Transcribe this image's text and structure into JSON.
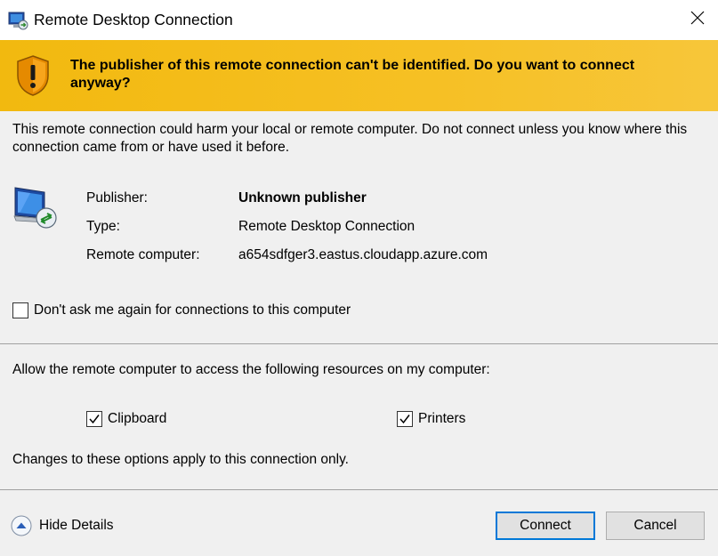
{
  "window": {
    "title": "Remote Desktop Connection"
  },
  "banner": {
    "text": "The publisher of this remote connection can't be identified. Do you want to connect anyway?"
  },
  "warning": {
    "text": "This remote connection could harm your local or remote computer. Do not connect unless you know where this connection came from or have used it before."
  },
  "details": {
    "publisher_label": "Publisher:",
    "publisher_value": "Unknown publisher",
    "type_label": "Type:",
    "type_value": "Remote Desktop Connection",
    "remote_label": "Remote computer:",
    "remote_value": "a654sdfger3.eastus.cloudapp.azure.com"
  },
  "dont_ask": {
    "label": "Don't ask me again for connections to this computer",
    "checked": false
  },
  "resources": {
    "heading": "Allow the remote computer to access the following resources on my computer:",
    "clipboard": {
      "label": "Clipboard",
      "checked": true
    },
    "printers": {
      "label": "Printers",
      "checked": true
    },
    "note": "Changes to these options apply to this connection only."
  },
  "footer": {
    "hide_details": "Hide Details",
    "connect": "Connect",
    "cancel": "Cancel"
  },
  "colors": {
    "banner": "#f6c024",
    "accent": "#0078d7",
    "panel": "#f0f0f0"
  },
  "icons": [
    "rdp-app-icon",
    "close-icon",
    "warning-shield-icon",
    "remote-monitor-icon",
    "check-icon",
    "chevron-up-icon"
  ]
}
